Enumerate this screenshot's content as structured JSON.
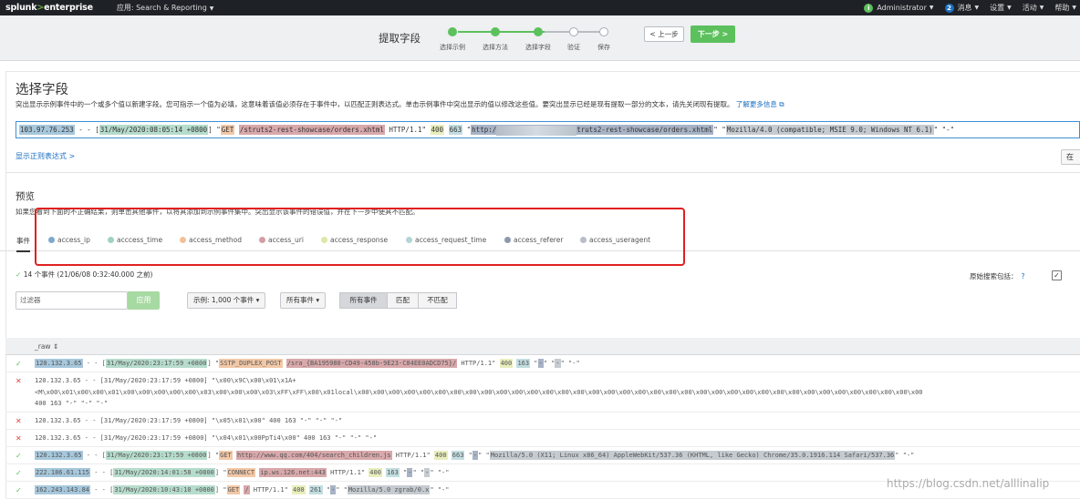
{
  "topbar": {
    "logo_a": "splunk",
    "logo_b": ">",
    "logo_c": "enterprise",
    "app": "应用: Search & Reporting",
    "user": "Administrator",
    "msg_count": "2",
    "messages": "消息",
    "settings": "设置",
    "activity": "活动",
    "help": "帮助"
  },
  "wizard": {
    "title": "提取字段",
    "steps": [
      "选择示例",
      "选择方法",
      "选择字段",
      "验证",
      "保存"
    ],
    "prev": "< 上一步",
    "next": "下一步 >"
  },
  "select": {
    "title": "选择字段",
    "desc": "突出显示示例事件中的一个或多个值以新建字段。您可指示一个值为必填，这意味着该值必须存在于事件中，以匹配正则表达式。单击示例事件中突出显示的值以修改这些值。要突出显示已经是现有提取一部分的文本，请先关闭现有提取。",
    "learn_more": "了解更多信息",
    "event": {
      "ip": "103.97.76.253",
      "d1": " - - [",
      "time": "31/May/2020:08:05:14 +0800",
      "d2": "] \"",
      "method": "GET",
      "d3": " ",
      "uri": "/struts2-rest-showcase/orders.xhtml",
      "d4": " HTTP/1.1\" ",
      "resp": "400",
      "d5": " ",
      "req": "663",
      "d6": " \"",
      "ref_a": "http:/",
      "ref_b": "truts2-rest-showcase/orders.xhtml",
      "d7": "\" \"",
      "ua": "Mozilla/4.0 (compatible; MSIE 9.0; Windows NT 6.1)",
      "d8": "\" \"-\""
    },
    "show_regex": "显示正则表达式 >",
    "side_button": "在"
  },
  "preview": {
    "title": "预览",
    "desc": "如果您看到下面的不正确结果，则单击其他事件，以将其添加到示例事件集中。突出显示该事件的错误值，并在下一步中使其不匹配。",
    "tab_events": "事件",
    "field_tabs": [
      {
        "name": "access_ip",
        "color": "#7fa8cc"
      },
      {
        "name": "acccess_time",
        "color": "#9fd2bf"
      },
      {
        "name": "access_method",
        "color": "#f0c19a"
      },
      {
        "name": "access_uri",
        "color": "#d49ea2"
      },
      {
        "name": "access_response",
        "color": "#dfe6a8"
      },
      {
        "name": "access_request_time",
        "color": "#b4d4d8"
      },
      {
        "name": "access_referer",
        "color": "#8b98ad"
      },
      {
        "name": "access_useragent",
        "color": "#b8bec4"
      }
    ],
    "check": "✓",
    "count": "14 个事件 (21/06/08 0:32:40.000 之前)",
    "raw_label": "原始搜索包括：",
    "raw_q": "?",
    "checkbox": "✓",
    "filter_placeholder": "过滤器",
    "apply": "应用",
    "sample": "示例: 1,000 个事件 ▾",
    "all_events_dd": "所有事件 ▾",
    "seg_all": "所有事件",
    "seg_match": "匹配",
    "seg_nomatch": "不匹配",
    "raw_col": "_raw ⇕"
  },
  "rows": {
    "r1": {
      "st": "✓",
      "ip": "120.132.3.65",
      "a": " - - [",
      "time": "31/May/2020:23:17:59 +0800",
      "b": "] \"",
      "method": "SSTP_DUPLEX_POST",
      "c": " ",
      "uri": "/sra_{BA195980-CD49-458b-9E23-C84EE0ADCD75}/",
      "d": " HTTP/1.1\" ",
      "resp": "400",
      "e": " ",
      "req": "163",
      "f": " \"",
      "ref": "-",
      "g": "\" \"",
      "ua": "-",
      "h": "\" \"-\""
    },
    "r2": {
      "st": "✕",
      "l1": "120.132.3.65 - - [31/May/2020:23:17:59 +0800] \"\\x00\\x9C\\x00\\x01\\x1A+",
      "l2": "<M\\x00\\x01\\x00\\x00\\x01\\x00\\x00\\x00\\x00\\x00\\x03\\x00\\x00\\x00\\x03\\xFF\\xFF\\x00\\x01local\\x00\\x00\\x00\\x00\\x00\\x00\\x00\\x00\\x00\\x00\\x00\\x00\\x00\\x00\\x00\\x00\\x00\\x00\\x00\\x00\\x00\\x00\\x00\\x00\\x00\\x00\\x00\\x00\\x00\\x00\\x00\\x00\\x00\\x00\\x00\\x00\\x00",
      "l3": "400 163 \"-\" \"-\" \"-\""
    },
    "r3": {
      "st": "✕",
      "txt": "120.132.3.65 - - [31/May/2020:23:17:59 +0800] \"\\x05\\x01\\x00\" 400 163 \"-\" \"-\" \"-\""
    },
    "r4": {
      "st": "✕",
      "txt": "120.132.3.65 - - [31/May/2020:23:17:59 +0800] \"\\x04\\x01\\x00PpTi4\\x00\" 400 163 \"-\" \"-\" \"-\""
    },
    "r5": {
      "st": "✓",
      "ip": "120.132.3.65",
      "a": " - - [",
      "time": "31/May/2020:23:17:59 +0800",
      "b": "] \"",
      "method": "GET",
      "c": " ",
      "uri": "http://www.qq.com/404/search_children.js",
      "d": " HTTP/1.1\" ",
      "resp": "400",
      "e": " ",
      "req": "663",
      "f": " \"",
      "ref": "-",
      "g": "\" \"",
      "ua": "Mozilla/5.0 (X11; Linux x86_64) AppleWebKit/537.36 (KHTML, like Gecko) Chrome/35.0.1916.114 Safari/537.36",
      "h": "\" \"-\""
    },
    "r6": {
      "st": "✓",
      "ip": "222.186.61.115",
      "a": " - - [",
      "time": "31/May/2020:14:01:58 +0800",
      "b": "] \"",
      "method": "CONNECT",
      "c": " ",
      "uri": "ip.ws.126.net:443",
      "d": " HTTP/1.1\" ",
      "resp": "400",
      "e": " ",
      "req": "163",
      "f": " \"",
      "ref": "-",
      "g": "\" \"",
      "ua": "-",
      "h": "\" \"-\""
    },
    "r7": {
      "st": "✓",
      "ip": "162.243.143.84",
      "a": " - - [",
      "time": "31/May/2020:10:43:10 +0800",
      "b": "] \"",
      "method": "GET",
      "c": " ",
      "uri": "/",
      "d": " HTTP/1.1\" ",
      "resp": "400",
      "e": " ",
      "req": "261",
      "f": " \"",
      "ref": "-",
      "g": "\" \"",
      "ua": "Mozilla/5.0 zgrab/0.x",
      "h": "\" \"-\""
    }
  },
  "watermark": "https://blog.csdn.net/alllinalip"
}
